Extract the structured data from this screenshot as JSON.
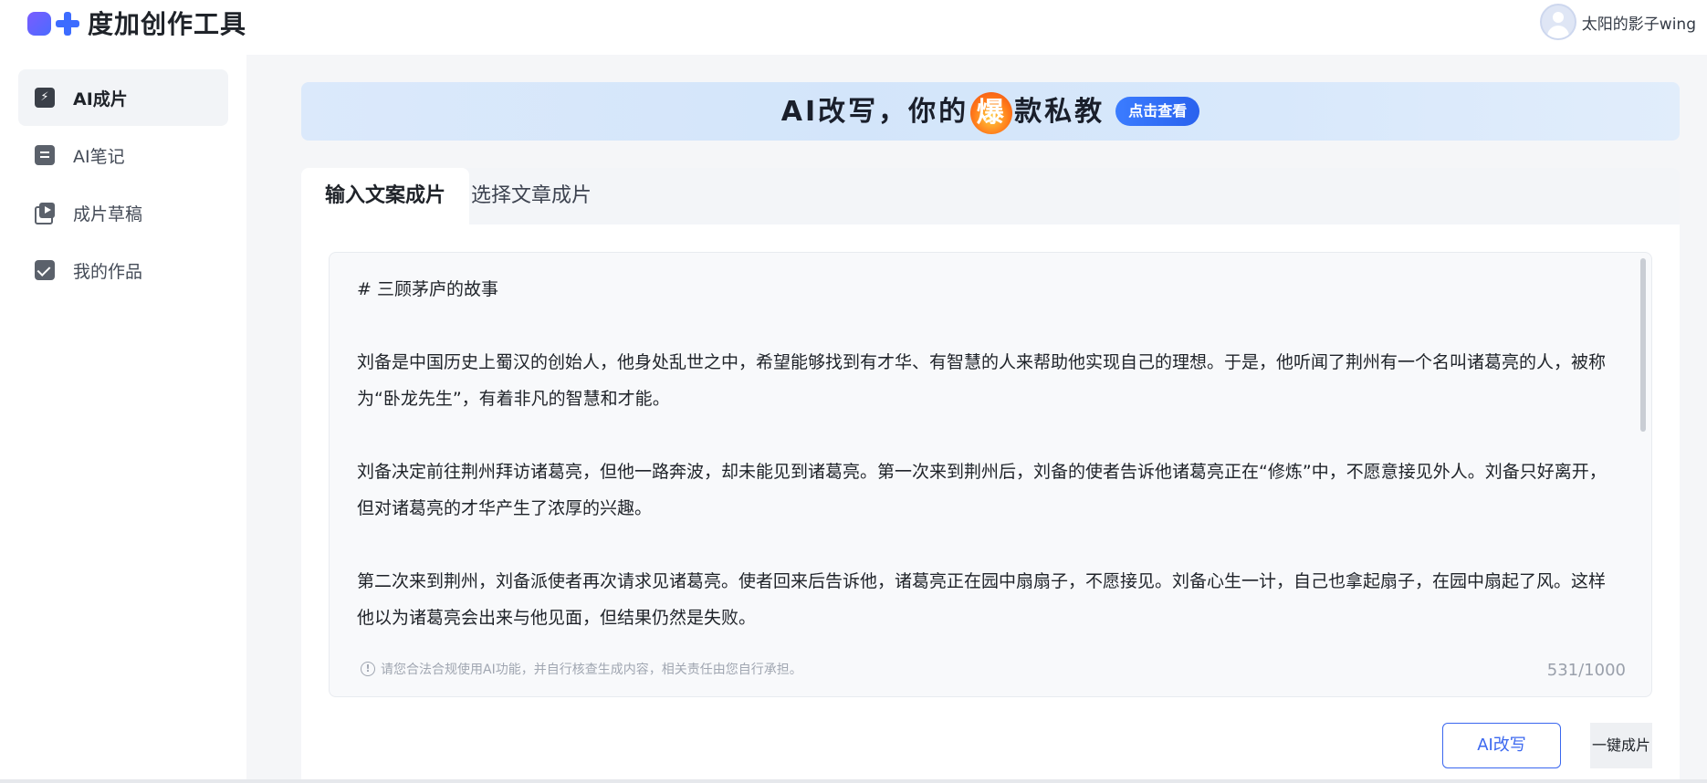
{
  "app": {
    "name": "度加创作工具"
  },
  "user": {
    "name": "太阳的影子wing"
  },
  "sidebar": {
    "items": [
      {
        "label": "AI成片",
        "icon": "bolt-icon",
        "active": true
      },
      {
        "label": "AI笔记",
        "icon": "note-icon",
        "active": false
      },
      {
        "label": "成片草稿",
        "icon": "video-draft-icon",
        "active": false
      },
      {
        "label": "我的作品",
        "icon": "check-square-icon",
        "active": false
      }
    ]
  },
  "banner": {
    "text_before": "AI改写，你的",
    "accent_char": "爆",
    "text_after": "款私教",
    "button_label": "点击查看"
  },
  "tabs": [
    {
      "label": "输入文案成片",
      "active": true
    },
    {
      "label": "选择文章成片",
      "active": false
    }
  ],
  "editor": {
    "content": "# 三顾茅庐的故事\n\n刘备是中国历史上蜀汉的创始人，他身处乱世之中，希望能够找到有才华、有智慧的人来帮助他实现自己的理想。于是，他听闻了荆州有一个名叫诸葛亮的人，被称为“卧龙先生”，有着非凡的智慧和才能。\n\n刘备决定前往荆州拜访诸葛亮，但他一路奔波，却未能见到诸葛亮。第一次来到荆州后，刘备的使者告诉他诸葛亮正在“修炼”中，不愿意接见外人。刘备只好离开，但对诸葛亮的才华产生了浓厚的兴趣。\n\n第二次来到荆州，刘备派使者再次请求见诸葛亮。使者回来后告诉他，诸葛亮正在园中扇扇子，不愿接见。刘备心生一计，自己也拿起扇子，在园中扇起了风。这样他以为诸葛亮会出来与他见面，但结果仍然是失败。",
    "disclaimer": "请您合法合规使用AI功能，并自行核查生成内容，相关责任由您自行承担。",
    "counter": "531/1000"
  },
  "actions": {
    "rewrite_label": "AI改写",
    "generate_label": "一键成片"
  },
  "colors": {
    "accent": "#3a67ef",
    "banner_button": "#2a62ee"
  }
}
